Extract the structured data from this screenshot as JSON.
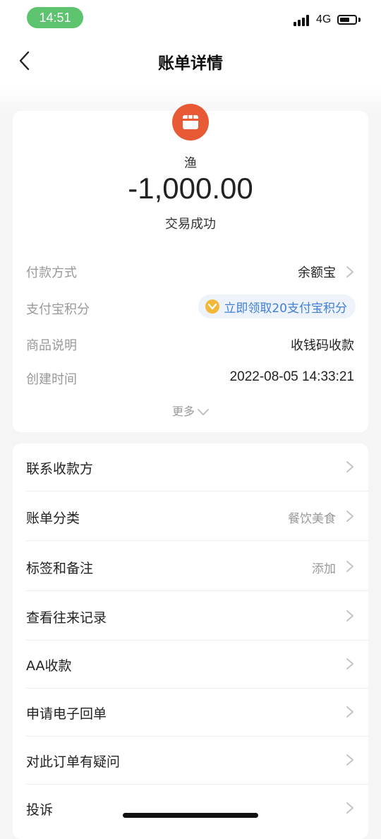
{
  "status_bar": {
    "time": "14:51",
    "network": "4G",
    "battery_level": 0.65
  },
  "nav": {
    "title": "账单详情"
  },
  "header": {
    "merchant_icon": "storefront-icon",
    "merchant_name": "渔",
    "amount": "-1,000.00",
    "status": "交易成功"
  },
  "details": [
    {
      "label": "付款方式",
      "value": "余额宝"
    },
    {
      "label": "支付宝积分",
      "value": "立即领取20支付宝积分"
    },
    {
      "label": "商品说明",
      "value": "收钱码收款"
    },
    {
      "label": "创建时间",
      "value": "2022-08-05 14:33:21"
    }
  ],
  "more_label": "更多",
  "menu": [
    {
      "label": "联系收款方",
      "value": ""
    },
    {
      "label": "账单分类",
      "value": "餐饮美食"
    },
    {
      "label": "标签和备注",
      "value": "添加"
    },
    {
      "label": "查看往来记录",
      "value": ""
    },
    {
      "label": "AA收款",
      "value": ""
    },
    {
      "label": "申请电子回单",
      "value": ""
    },
    {
      "label": "对此订单有疑问",
      "value": ""
    },
    {
      "label": "投诉",
      "value": ""
    }
  ],
  "colors": {
    "accent": "#e85a36",
    "link": "#3f7fd6",
    "time_pill": "#5dc36f"
  }
}
